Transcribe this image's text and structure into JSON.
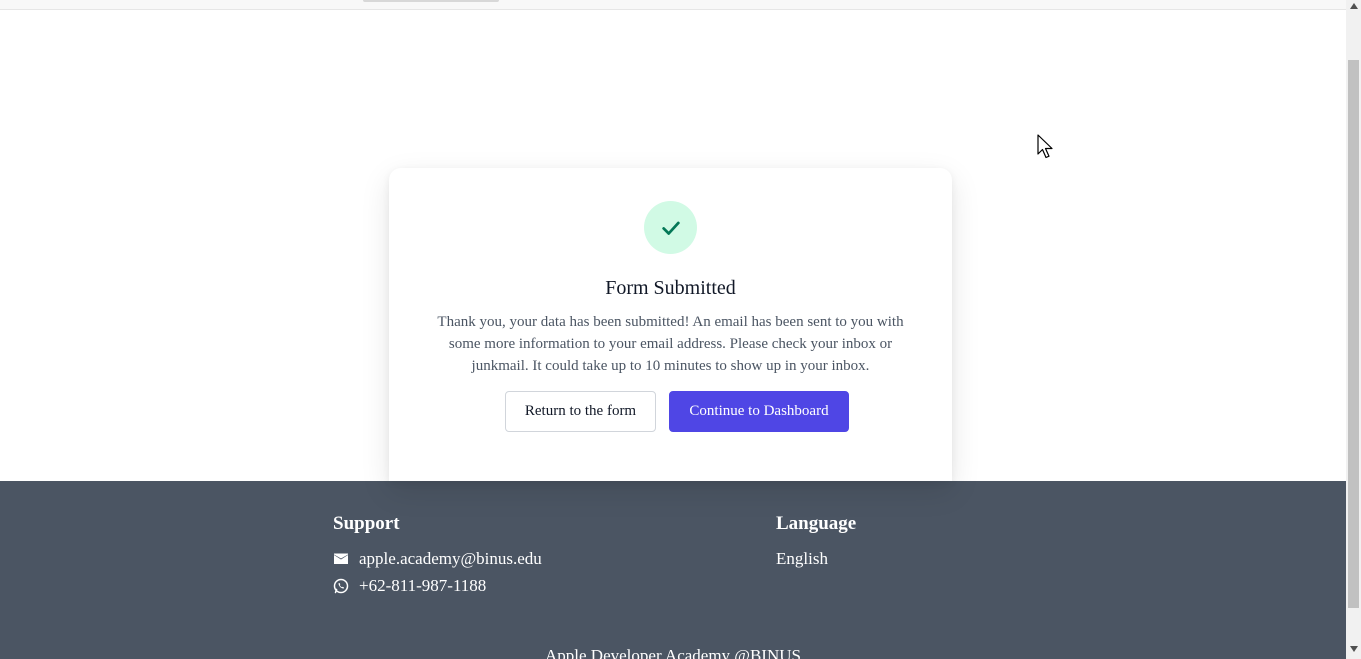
{
  "card": {
    "icon": "check-icon",
    "title": "Form Submitted",
    "message": "Thank you, your data has been submitted! An email has been sent to you with some more information to your email address. Please check your inbox or junkmail. It could take up to 10 minutes to show up in your inbox.",
    "return_button": "Return to the form",
    "continue_button": "Continue to Dashboard"
  },
  "footer": {
    "support_heading": "Support",
    "email": "apple.academy@binus.edu",
    "phone": "+62-811-987-1188",
    "language_heading": "Language",
    "language_value": "English",
    "bottom_text": "Apple Developer Academy @BINUS"
  },
  "colors": {
    "accent": "#4f46e5",
    "success_bg": "#d1fae5",
    "success_icon": "#047857",
    "footer_bg": "#4b5563"
  }
}
